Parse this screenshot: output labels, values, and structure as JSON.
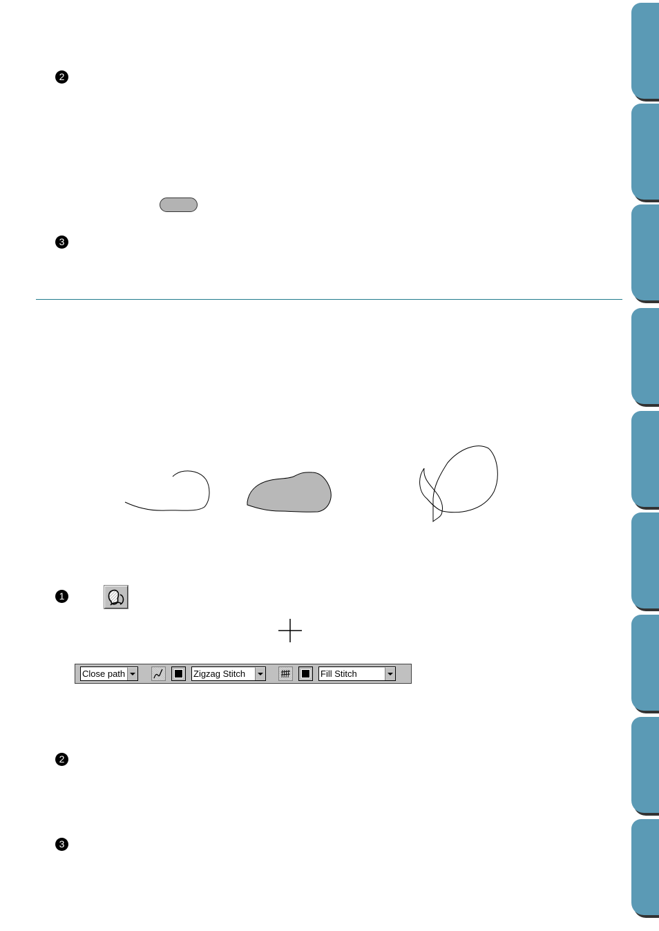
{
  "steps_top": [
    {
      "number": "2"
    },
    {
      "number": "3"
    }
  ],
  "steps_bottom": [
    {
      "number": "1"
    },
    {
      "number": "2"
    },
    {
      "number": "3"
    }
  ],
  "button_illustration": {
    "label": ""
  },
  "figures": [
    {
      "name": "open-path-curve",
      "description": "Open path"
    },
    {
      "name": "filled-shape",
      "description": "Filled closed shape",
      "fill": "#b8b8b8"
    },
    {
      "name": "looped-path",
      "description": "Self-intersecting path"
    }
  ],
  "tool": {
    "icon": "freehand-curve-tool-icon"
  },
  "cursor": {
    "icon": "crosshair-icon"
  },
  "toolbar": {
    "path_mode": {
      "value": "Close path"
    },
    "line_sew_icon": "line-sew-type-icon",
    "line_color_icon": "line-color-icon",
    "line_stitch": {
      "value": "Zigzag Stitch"
    },
    "region_sew_icon": "region-sew-type-icon",
    "region_color_icon": "region-color-icon",
    "region_stitch": {
      "value": "Fill Stitch"
    }
  },
  "side_tabs": [
    {
      "index": 1
    },
    {
      "index": 2
    },
    {
      "index": 3
    },
    {
      "index": 4
    },
    {
      "index": 5
    },
    {
      "index": 6
    },
    {
      "index": 7
    },
    {
      "index": 8
    },
    {
      "index": 9
    }
  ],
  "colors": {
    "tab": "#5b9ab5",
    "tab_shadow": "#333333",
    "rule": "#1f7a8c",
    "ui_gray": "#c0c0c0"
  }
}
